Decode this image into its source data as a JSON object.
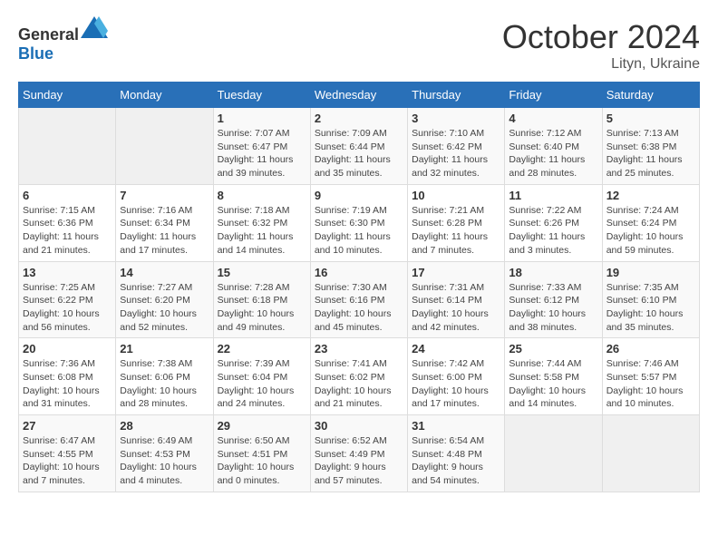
{
  "header": {
    "logo_general": "General",
    "logo_blue": "Blue",
    "month": "October 2024",
    "location": "Lityn, Ukraine"
  },
  "days_of_week": [
    "Sunday",
    "Monday",
    "Tuesday",
    "Wednesday",
    "Thursday",
    "Friday",
    "Saturday"
  ],
  "weeks": [
    [
      {
        "day": "",
        "info": ""
      },
      {
        "day": "",
        "info": ""
      },
      {
        "day": "1",
        "info": "Sunrise: 7:07 AM\nSunset: 6:47 PM\nDaylight: 11 hours and 39 minutes."
      },
      {
        "day": "2",
        "info": "Sunrise: 7:09 AM\nSunset: 6:44 PM\nDaylight: 11 hours and 35 minutes."
      },
      {
        "day": "3",
        "info": "Sunrise: 7:10 AM\nSunset: 6:42 PM\nDaylight: 11 hours and 32 minutes."
      },
      {
        "day": "4",
        "info": "Sunrise: 7:12 AM\nSunset: 6:40 PM\nDaylight: 11 hours and 28 minutes."
      },
      {
        "day": "5",
        "info": "Sunrise: 7:13 AM\nSunset: 6:38 PM\nDaylight: 11 hours and 25 minutes."
      }
    ],
    [
      {
        "day": "6",
        "info": "Sunrise: 7:15 AM\nSunset: 6:36 PM\nDaylight: 11 hours and 21 minutes."
      },
      {
        "day": "7",
        "info": "Sunrise: 7:16 AM\nSunset: 6:34 PM\nDaylight: 11 hours and 17 minutes."
      },
      {
        "day": "8",
        "info": "Sunrise: 7:18 AM\nSunset: 6:32 PM\nDaylight: 11 hours and 14 minutes."
      },
      {
        "day": "9",
        "info": "Sunrise: 7:19 AM\nSunset: 6:30 PM\nDaylight: 11 hours and 10 minutes."
      },
      {
        "day": "10",
        "info": "Sunrise: 7:21 AM\nSunset: 6:28 PM\nDaylight: 11 hours and 7 minutes."
      },
      {
        "day": "11",
        "info": "Sunrise: 7:22 AM\nSunset: 6:26 PM\nDaylight: 11 hours and 3 minutes."
      },
      {
        "day": "12",
        "info": "Sunrise: 7:24 AM\nSunset: 6:24 PM\nDaylight: 10 hours and 59 minutes."
      }
    ],
    [
      {
        "day": "13",
        "info": "Sunrise: 7:25 AM\nSunset: 6:22 PM\nDaylight: 10 hours and 56 minutes."
      },
      {
        "day": "14",
        "info": "Sunrise: 7:27 AM\nSunset: 6:20 PM\nDaylight: 10 hours and 52 minutes."
      },
      {
        "day": "15",
        "info": "Sunrise: 7:28 AM\nSunset: 6:18 PM\nDaylight: 10 hours and 49 minutes."
      },
      {
        "day": "16",
        "info": "Sunrise: 7:30 AM\nSunset: 6:16 PM\nDaylight: 10 hours and 45 minutes."
      },
      {
        "day": "17",
        "info": "Sunrise: 7:31 AM\nSunset: 6:14 PM\nDaylight: 10 hours and 42 minutes."
      },
      {
        "day": "18",
        "info": "Sunrise: 7:33 AM\nSunset: 6:12 PM\nDaylight: 10 hours and 38 minutes."
      },
      {
        "day": "19",
        "info": "Sunrise: 7:35 AM\nSunset: 6:10 PM\nDaylight: 10 hours and 35 minutes."
      }
    ],
    [
      {
        "day": "20",
        "info": "Sunrise: 7:36 AM\nSunset: 6:08 PM\nDaylight: 10 hours and 31 minutes."
      },
      {
        "day": "21",
        "info": "Sunrise: 7:38 AM\nSunset: 6:06 PM\nDaylight: 10 hours and 28 minutes."
      },
      {
        "day": "22",
        "info": "Sunrise: 7:39 AM\nSunset: 6:04 PM\nDaylight: 10 hours and 24 minutes."
      },
      {
        "day": "23",
        "info": "Sunrise: 7:41 AM\nSunset: 6:02 PM\nDaylight: 10 hours and 21 minutes."
      },
      {
        "day": "24",
        "info": "Sunrise: 7:42 AM\nSunset: 6:00 PM\nDaylight: 10 hours and 17 minutes."
      },
      {
        "day": "25",
        "info": "Sunrise: 7:44 AM\nSunset: 5:58 PM\nDaylight: 10 hours and 14 minutes."
      },
      {
        "day": "26",
        "info": "Sunrise: 7:46 AM\nSunset: 5:57 PM\nDaylight: 10 hours and 10 minutes."
      }
    ],
    [
      {
        "day": "27",
        "info": "Sunrise: 6:47 AM\nSunset: 4:55 PM\nDaylight: 10 hours and 7 minutes."
      },
      {
        "day": "28",
        "info": "Sunrise: 6:49 AM\nSunset: 4:53 PM\nDaylight: 10 hours and 4 minutes."
      },
      {
        "day": "29",
        "info": "Sunrise: 6:50 AM\nSunset: 4:51 PM\nDaylight: 10 hours and 0 minutes."
      },
      {
        "day": "30",
        "info": "Sunrise: 6:52 AM\nSunset: 4:49 PM\nDaylight: 9 hours and 57 minutes."
      },
      {
        "day": "31",
        "info": "Sunrise: 6:54 AM\nSunset: 4:48 PM\nDaylight: 9 hours and 54 minutes."
      },
      {
        "day": "",
        "info": ""
      },
      {
        "day": "",
        "info": ""
      }
    ]
  ]
}
